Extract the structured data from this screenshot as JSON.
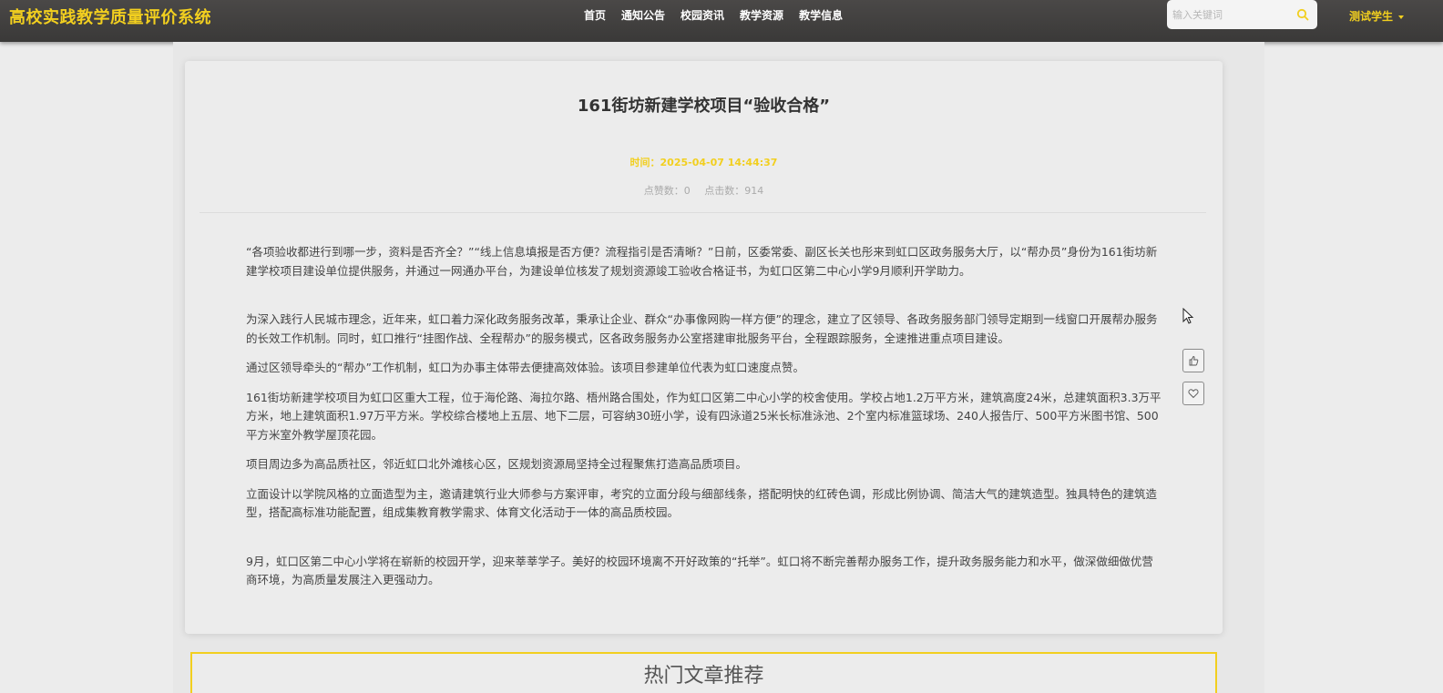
{
  "header": {
    "brand": "高校实践教学质量评价系统",
    "nav": [
      "首页",
      "通知公告",
      "校园资讯",
      "教学资源",
      "教学信息"
    ],
    "search_placeholder": "输入关键词",
    "user": "测试学生",
    "accent_color": "#f2cf1f"
  },
  "article": {
    "title": "161街坊新建学校项目“验收合格”",
    "time": "时间：2025-04-07 14:44:37",
    "likes": "点赞数：0",
    "clicks": "点击数：914",
    "paragraphs": [
      "“各项验收都进行到哪一步，资料是否齐全？”“线上信息填报是否方便？流程指引是否清晰？”日前，区委常委、副区长关也彤来到虹口区政务服务大厅，以“帮办员”身份为161街坊新建学校项目建设单位提供服务，并通过一网通办平台，为建设单位核发了规划资源竣工验收合格证书，为虹口区第二中心小学9月顺利开学助力。",
      "为深入践行人民城市理念，近年来，虹口着力深化政务服务改革，秉承让企业、群众“办事像网购一样方便”的理念，建立了区领导、各政务服务部门领导定期到一线窗口开展帮办服务的长效工作机制。同时，虹口推行“挂图作战、全程帮办”的服务模式，区各政务服务办公室搭建审批服务平台，全程跟踪服务，全速推进重点项目建设。",
      "通过区领导牵头的“帮办”工作机制，虹口为办事主体带去便捷高效体验。该项目参建单位代表为虹口速度点赞。",
      "161街坊新建学校项目为虹口区重大工程，位于海伦路、海拉尔路、梧州路合围处，作为虹口区第二中心小学的校舍使用。学校占地1.2万平方米，建筑高度24米，总建筑面积3.3万平方米，地上建筑面积1.97万平方米。学校综合楼地上五层、地下二层，可容纳30班小学，设有四泳道25米长标准泳池、2个室内标准篮球场、240人报告厅、500平方米图书馆、500平方米室外教学屋顶花园。",
      "项目周边多为高品质社区，邻近虹口北外滩核心区，区规划资源局坚持全过程聚焦打造高品质项目。",
      "立面设计以学院风格的立面造型为主，邀请建筑行业大师参与方案评审，考究的立面分段与细部线条，搭配明快的红砖色调，形成比例协调、简洁大气的建筑造型。独具特色的建筑造型，搭配高标准功能配置，组成集教育教学需求、体育文化活动于一体的高品质校园。",
      "9月，虹口区第二中心小学将在崭新的校园开学，迎来莘莘学子。美好的校园环境离不开好政策的“托举”。虹口将不断完善帮办服务工作，提升政务服务能力和水平，做深做细做优营商环境，为高质量发展注入更强动力。"
    ]
  },
  "recommend": {
    "title": "热门文章推荐"
  }
}
